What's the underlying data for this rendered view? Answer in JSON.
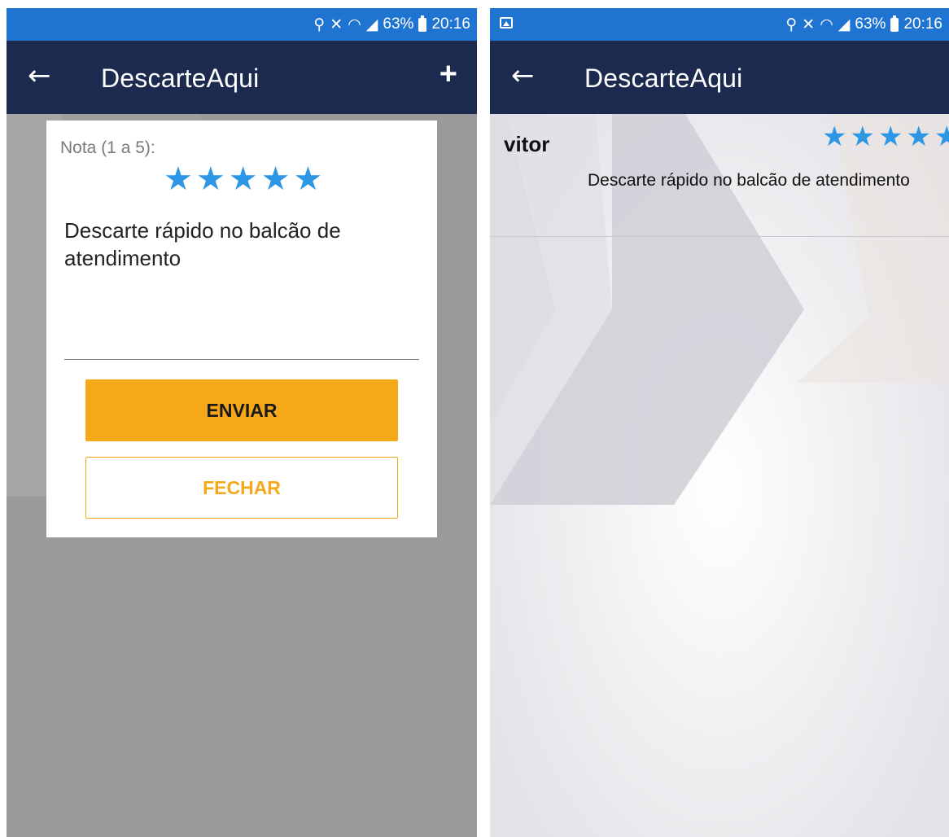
{
  "status": {
    "battery": "63%",
    "time": "20:16",
    "icons": [
      "location-icon",
      "mute-icon",
      "wifi-icon",
      "signal-icon",
      "battery-icon"
    ]
  },
  "appbar": {
    "title": "DescarteAqui",
    "back_icon": "back-arrow-icon",
    "add_icon": "plus-icon"
  },
  "rating_dialog": {
    "label": "Nota (1 a 5):",
    "rating": 5,
    "max_rating": 5,
    "comment": "Descarte rápido no balcão de atendimento",
    "submit_label": "ENVIAR",
    "close_label": "FECHAR"
  },
  "reviews": [
    {
      "user": "vitor",
      "rating": 5,
      "comment": "Descarte rápido no balcão de atendimento"
    }
  ],
  "colors": {
    "status_bar": "#1e74d0",
    "app_bar": "#1c2a4f",
    "star": "#2d97e6",
    "accent": "#f6a818"
  }
}
